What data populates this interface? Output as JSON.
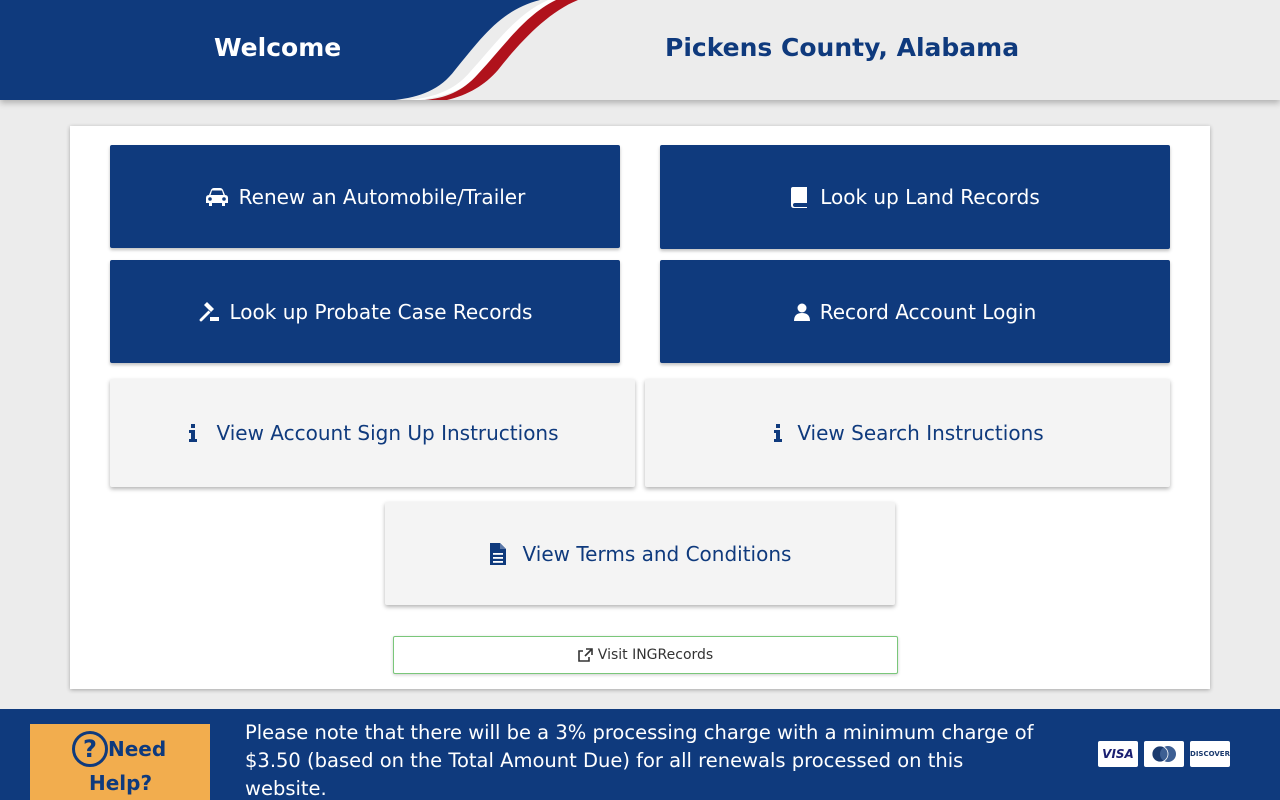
{
  "header": {
    "welcome": "Welcome",
    "county": "Pickens County, Alabama"
  },
  "actions": {
    "renew": {
      "label": "Renew an Automobile/Trailer",
      "icon": "car-icon"
    },
    "land": {
      "label": "Look up Land Records",
      "icon": "book-icon"
    },
    "probate": {
      "label": "Look up Probate Case Records",
      "icon": "gavel-icon"
    },
    "login": {
      "label": "Record Account Login",
      "icon": "user-icon"
    },
    "signup_instructions": {
      "label": "View Account Sign Up Instructions",
      "icon": "info-icon"
    },
    "search_instructions": {
      "label": "View Search Instructions",
      "icon": "info-icon"
    },
    "terms": {
      "label": "View Terms and Conditions",
      "icon": "document-icon"
    },
    "visit": {
      "label": "Visit INGRecords",
      "icon": "external-link-icon"
    }
  },
  "footer": {
    "help_word1": "Need",
    "help_word2": "Help?",
    "help_symbol": "?",
    "notice": "Please note that there will be a 3% processing charge with a minimum charge of $3.50 (based on the Total Amount Due) for all renewals processed on this website.",
    "cards": [
      "VISA",
      "MasterCard",
      "DISCOVER"
    ]
  },
  "colors": {
    "primary": "#0f3a7d",
    "help_bg": "#f2ad4e",
    "accent_red": "#b0121c",
    "visit_border": "#7ac77a"
  }
}
